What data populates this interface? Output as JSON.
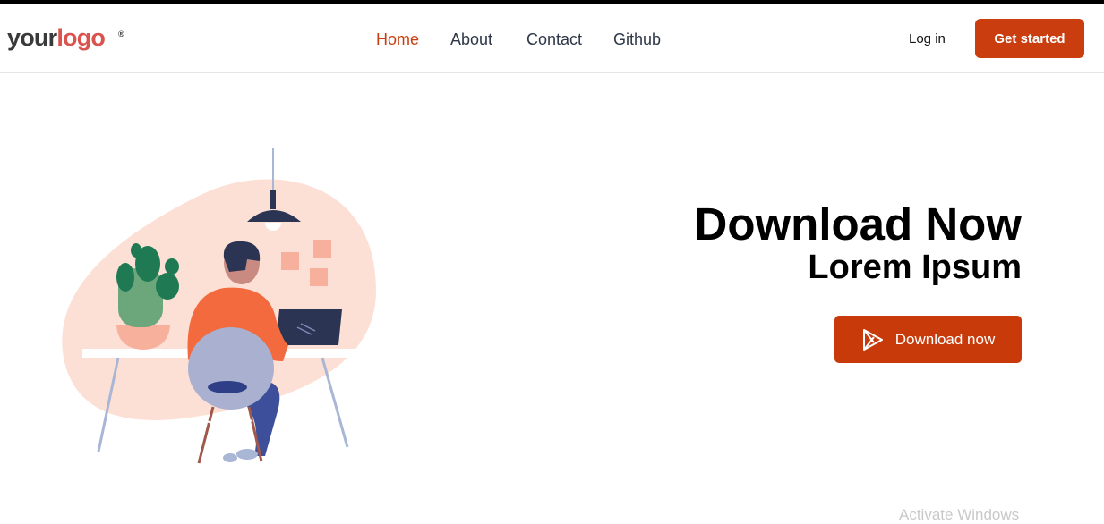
{
  "header": {
    "logo_part1": "your",
    "logo_part2": "logo",
    "logo_mark": "®",
    "nav": [
      {
        "label": "Home",
        "active": true
      },
      {
        "label": "About"
      },
      {
        "label": "Contact"
      },
      {
        "label": "Github"
      }
    ],
    "login_label": "Log in",
    "cta_label": "Get started"
  },
  "hero": {
    "title": "Download Now",
    "subtitle": "Lorem Ipsum",
    "button_label": "Download now",
    "button_icon": "play-store-icon",
    "illustration": "person-working-at-desk-illustration"
  },
  "overlay": {
    "watermark_text": "Activate Windows"
  },
  "colors": {
    "accent": "#c93e10",
    "nav_text": "#2d3748",
    "logo_gray": "#3a3a3a",
    "logo_red": "#d9534f",
    "blob": "#fde0d5"
  }
}
